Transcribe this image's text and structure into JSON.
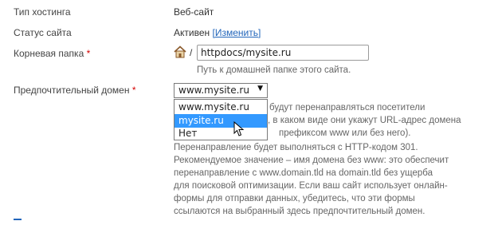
{
  "rows": {
    "hosting_type": {
      "label": "Тип хостинга",
      "value": "Веб-сайт"
    },
    "site_status": {
      "label": "Статус сайта",
      "value": "Активен",
      "change_link": "[Изменить]"
    },
    "root_folder": {
      "label": "Корневая папка",
      "required_mark": "*",
      "separator": "/",
      "input_value": "httpdocs/mysite.ru",
      "hint": "Путь к домашней папке этого сайта."
    },
    "preferred_domain": {
      "label": "Предпочтительный домен",
      "required_mark": "*",
      "selected": "www.mysite.ru",
      "options": [
        "www.mysite.ru",
        "mysite.ru",
        "Нет"
      ],
      "highlighted_index": 1,
      "description_lines": [
        "будут перенаправляться посетители",
        ", в каком виде они укажут URL-адрес домена",
        "префиксом www или без него).",
        "Перенаправление будет выполняться с HTTP-кодом 301.",
        "Рекомендуемое значение – имя домена без www: это обеспечит",
        "перенаправление с www.domain.tld на domain.tld без ущерба",
        "для поисковой оптимизации. Если ваш сайт использует онлайн-",
        "формы для отправки данных, убедитесь, что эти формы",
        "ссылаются на выбранный здесь предпочтительный домен."
      ]
    }
  },
  "icons": {
    "home": "home-icon",
    "cursor": "mouse-pointer-icon",
    "dropdown_arrow": "triangle-down-icon"
  },
  "colors": {
    "link": "#2266bb",
    "required": "#d40000",
    "highlight": "#3399ff"
  }
}
